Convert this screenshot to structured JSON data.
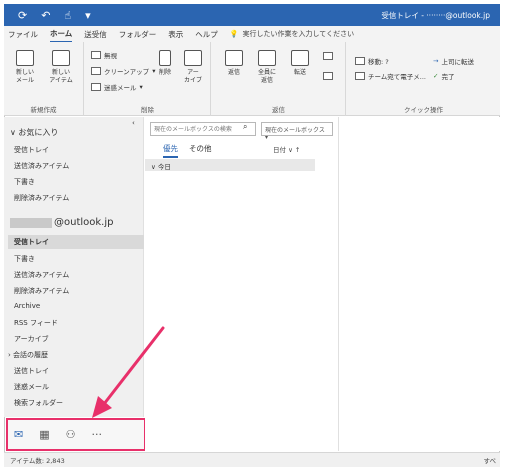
{
  "titlebar": {
    "window_title": "受信トレイ - ········@outlook.jp",
    "qa_icons": [
      "sync-icon",
      "undo-icon",
      "touch-icon",
      "customize-icon"
    ]
  },
  "menu": {
    "tabs": [
      "ファイル",
      "ホーム",
      "送受信",
      "フォルダー",
      "表示",
      "ヘルプ"
    ],
    "active_tab": "ホーム",
    "tell_me": "実行したい作業を入力してください"
  },
  "ribbon": {
    "new_group": {
      "label": "新規作成",
      "new_mail": "新しい\nメール",
      "new_items": "新しい\nアイテム"
    },
    "delete_group": {
      "label": "削除",
      "ignore": "無視",
      "cleanup": "クリーンアップ",
      "junk": "迷惑メール",
      "delete": "削除",
      "archive": "アー\nカイブ"
    },
    "respond_group": {
      "label": "返信",
      "reply": "返信",
      "reply_all": "全員に\n返信",
      "forward": "転送"
    },
    "quick_group": {
      "label": "クイック操作",
      "move_to": "移動: ?",
      "team_email": "チーム宛て電子メ...",
      "to_manager": "上司に転送",
      "done": "完了"
    }
  },
  "folders": {
    "favorites_label": "お気に入り",
    "favorites": [
      "受信トレイ",
      "送信済みアイテム",
      "下書き",
      "削除済みアイテム"
    ],
    "account": "@outlook.jp",
    "account_folders": [
      "受信トレイ",
      "下書き",
      "送信済みアイテム",
      "削除済みアイテム",
      "Archive",
      "RSS フィード",
      "アーカイブ",
      "会話の履歴",
      "送信トレイ",
      "迷惑メール",
      "検索フォルダー"
    ],
    "selected": "受信トレイ"
  },
  "nav": {
    "icons": [
      "mail-icon",
      "calendar-icon",
      "people-icon",
      "more-icon"
    ],
    "more_label": "···"
  },
  "list": {
    "search_placeholder": "現在のメールボックスの検索",
    "scope": "現在のメールボックス",
    "tab_focused": "優先",
    "tab_other": "その他",
    "sort": "日付",
    "group_today": "今日"
  },
  "status": {
    "items": "アイテム数: 2,843",
    "right": "すべ"
  },
  "colors": {
    "accent": "#2b65b1",
    "highlight": "#e8306a"
  }
}
